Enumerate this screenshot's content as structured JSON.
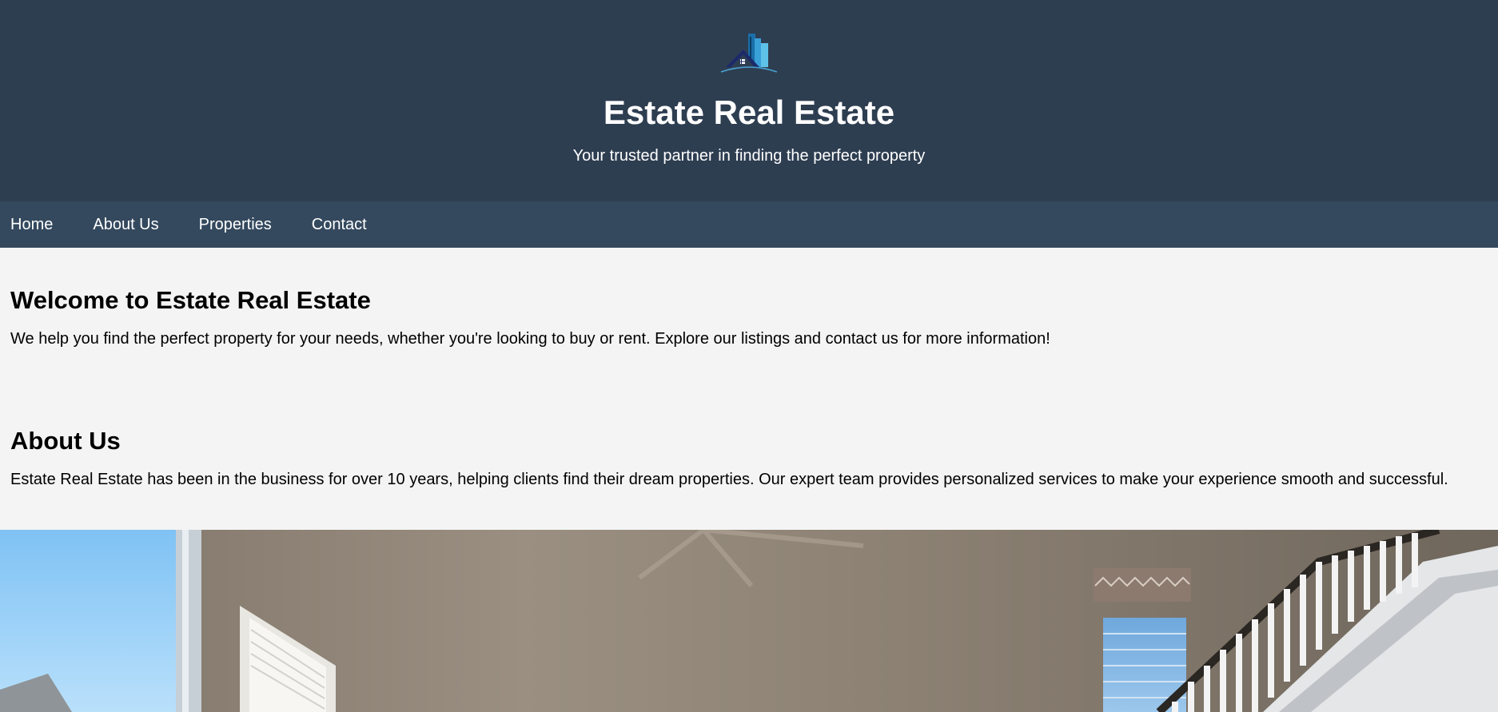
{
  "header": {
    "title": "Estate Real Estate",
    "tagline": "Your trusted partner in finding the perfect property",
    "background_color": "#2e3e51",
    "logo_icon": "building-house-logo-icon"
  },
  "nav": {
    "background_color": "#34495e",
    "items": [
      {
        "label": "Home"
      },
      {
        "label": "About Us"
      },
      {
        "label": "Properties"
      },
      {
        "label": "Contact"
      }
    ]
  },
  "welcome": {
    "heading": "Welcome to Estate Real Estate",
    "text": "We help you find the perfect property for your needs, whether you're looking to buy or rent. Explore our listings and contact us for more information!"
  },
  "about": {
    "heading": "About Us",
    "text": "Estate Real Estate has been in the business for over 10 years, helping clients find their dream properties. Our expert team provides personalized services to make your experience smooth and successful."
  },
  "hero": {
    "image": "interior-living-room-photo"
  }
}
